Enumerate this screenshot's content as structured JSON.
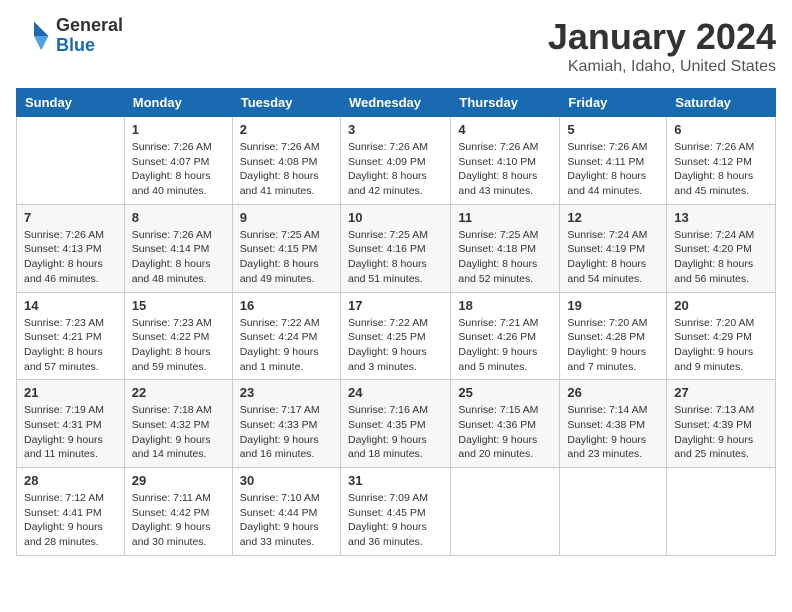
{
  "header": {
    "logo_general": "General",
    "logo_blue": "Blue",
    "title": "January 2024",
    "subtitle": "Kamiah, Idaho, United States"
  },
  "columns": [
    "Sunday",
    "Monday",
    "Tuesday",
    "Wednesday",
    "Thursday",
    "Friday",
    "Saturday"
  ],
  "weeks": [
    [
      {
        "day": "",
        "info": ""
      },
      {
        "day": "1",
        "info": "Sunrise: 7:26 AM\nSunset: 4:07 PM\nDaylight: 8 hours and 40 minutes."
      },
      {
        "day": "2",
        "info": "Sunrise: 7:26 AM\nSunset: 4:08 PM\nDaylight: 8 hours and 41 minutes."
      },
      {
        "day": "3",
        "info": "Sunrise: 7:26 AM\nSunset: 4:09 PM\nDaylight: 8 hours and 42 minutes."
      },
      {
        "day": "4",
        "info": "Sunrise: 7:26 AM\nSunset: 4:10 PM\nDaylight: 8 hours and 43 minutes."
      },
      {
        "day": "5",
        "info": "Sunrise: 7:26 AM\nSunset: 4:11 PM\nDaylight: 8 hours and 44 minutes."
      },
      {
        "day": "6",
        "info": "Sunrise: 7:26 AM\nSunset: 4:12 PM\nDaylight: 8 hours and 45 minutes."
      }
    ],
    [
      {
        "day": "7",
        "info": "Sunrise: 7:26 AM\nSunset: 4:13 PM\nDaylight: 8 hours and 46 minutes."
      },
      {
        "day": "8",
        "info": "Sunrise: 7:26 AM\nSunset: 4:14 PM\nDaylight: 8 hours and 48 minutes."
      },
      {
        "day": "9",
        "info": "Sunrise: 7:25 AM\nSunset: 4:15 PM\nDaylight: 8 hours and 49 minutes."
      },
      {
        "day": "10",
        "info": "Sunrise: 7:25 AM\nSunset: 4:16 PM\nDaylight: 8 hours and 51 minutes."
      },
      {
        "day": "11",
        "info": "Sunrise: 7:25 AM\nSunset: 4:18 PM\nDaylight: 8 hours and 52 minutes."
      },
      {
        "day": "12",
        "info": "Sunrise: 7:24 AM\nSunset: 4:19 PM\nDaylight: 8 hours and 54 minutes."
      },
      {
        "day": "13",
        "info": "Sunrise: 7:24 AM\nSunset: 4:20 PM\nDaylight: 8 hours and 56 minutes."
      }
    ],
    [
      {
        "day": "14",
        "info": "Sunrise: 7:23 AM\nSunset: 4:21 PM\nDaylight: 8 hours and 57 minutes."
      },
      {
        "day": "15",
        "info": "Sunrise: 7:23 AM\nSunset: 4:22 PM\nDaylight: 8 hours and 59 minutes."
      },
      {
        "day": "16",
        "info": "Sunrise: 7:22 AM\nSunset: 4:24 PM\nDaylight: 9 hours and 1 minute."
      },
      {
        "day": "17",
        "info": "Sunrise: 7:22 AM\nSunset: 4:25 PM\nDaylight: 9 hours and 3 minutes."
      },
      {
        "day": "18",
        "info": "Sunrise: 7:21 AM\nSunset: 4:26 PM\nDaylight: 9 hours and 5 minutes."
      },
      {
        "day": "19",
        "info": "Sunrise: 7:20 AM\nSunset: 4:28 PM\nDaylight: 9 hours and 7 minutes."
      },
      {
        "day": "20",
        "info": "Sunrise: 7:20 AM\nSunset: 4:29 PM\nDaylight: 9 hours and 9 minutes."
      }
    ],
    [
      {
        "day": "21",
        "info": "Sunrise: 7:19 AM\nSunset: 4:31 PM\nDaylight: 9 hours and 11 minutes."
      },
      {
        "day": "22",
        "info": "Sunrise: 7:18 AM\nSunset: 4:32 PM\nDaylight: 9 hours and 14 minutes."
      },
      {
        "day": "23",
        "info": "Sunrise: 7:17 AM\nSunset: 4:33 PM\nDaylight: 9 hours and 16 minutes."
      },
      {
        "day": "24",
        "info": "Sunrise: 7:16 AM\nSunset: 4:35 PM\nDaylight: 9 hours and 18 minutes."
      },
      {
        "day": "25",
        "info": "Sunrise: 7:15 AM\nSunset: 4:36 PM\nDaylight: 9 hours and 20 minutes."
      },
      {
        "day": "26",
        "info": "Sunrise: 7:14 AM\nSunset: 4:38 PM\nDaylight: 9 hours and 23 minutes."
      },
      {
        "day": "27",
        "info": "Sunrise: 7:13 AM\nSunset: 4:39 PM\nDaylight: 9 hours and 25 minutes."
      }
    ],
    [
      {
        "day": "28",
        "info": "Sunrise: 7:12 AM\nSunset: 4:41 PM\nDaylight: 9 hours and 28 minutes."
      },
      {
        "day": "29",
        "info": "Sunrise: 7:11 AM\nSunset: 4:42 PM\nDaylight: 9 hours and 30 minutes."
      },
      {
        "day": "30",
        "info": "Sunrise: 7:10 AM\nSunset: 4:44 PM\nDaylight: 9 hours and 33 minutes."
      },
      {
        "day": "31",
        "info": "Sunrise: 7:09 AM\nSunset: 4:45 PM\nDaylight: 9 hours and 36 minutes."
      },
      {
        "day": "",
        "info": ""
      },
      {
        "day": "",
        "info": ""
      },
      {
        "day": "",
        "info": ""
      }
    ]
  ]
}
